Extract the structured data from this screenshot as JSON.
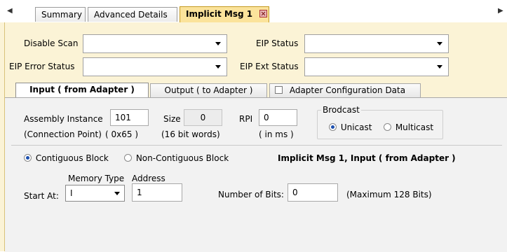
{
  "tabs": {
    "summary": "Summary",
    "advanced": "Advanced Details",
    "implicit": "Implicit Msg 1"
  },
  "config": {
    "disable_scan_label": "Disable Scan",
    "eip_status_label": "EIP Status",
    "eip_error_status_label": "EIP Error Status",
    "eip_ext_status_label": "EIP Ext Status"
  },
  "subtabs": {
    "input": "Input ( from Adapter )",
    "output": "Output ( to Adapter )",
    "adapter_config": "Adapter Configuration Data"
  },
  "input_panel": {
    "assembly_instance_label": "Assembly Instance",
    "assembly_instance_value": "101",
    "connection_point_label": "(Connection Point)",
    "connection_point_hex": "( 0x65 )",
    "size_label": "Size",
    "size_value": "0",
    "size_unit": "(16 bit words)",
    "rpi_label": "RPI",
    "rpi_value": "0",
    "rpi_unit": "( in ms )",
    "broadcast_title": "Brodcast",
    "unicast_label": "Unicast",
    "multicast_label": "Multicast",
    "contiguous_label": "Contiguous Block",
    "non_contiguous_label": "Non-Contiguous Block",
    "section_title": "Implicit Msg 1, Input ( from Adapter )",
    "memory_type_label": "Memory Type",
    "address_label": "Address",
    "start_at_label": "Start At:",
    "memory_type_value": "I",
    "address_value": "1",
    "num_bits_label": "Number of Bits:",
    "num_bits_value": "0",
    "max_bits_note": "(Maximum 128 Bits)"
  }
}
